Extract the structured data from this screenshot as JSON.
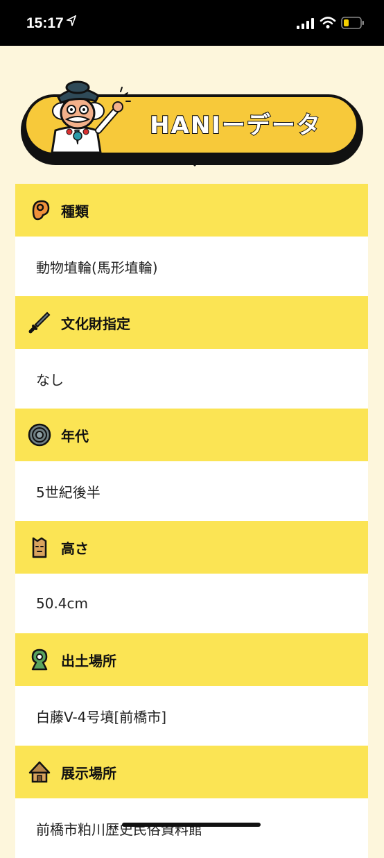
{
  "status_bar": {
    "time": "15:17"
  },
  "banner": {
    "title": "HANIーデータ"
  },
  "sections": [
    {
      "title": "種類",
      "value": "動物埴輪(馬形埴輪)",
      "icon": "haniwa-head-icon"
    },
    {
      "title": "文化財指定",
      "value": "なし",
      "icon": "sword-icon"
    },
    {
      "title": "年代",
      "value": "5世紀後半",
      "icon": "bronze-mirror-icon"
    },
    {
      "title": "高さ",
      "value": "50.4cm",
      "icon": "haniwa-figure-icon"
    },
    {
      "title": "出土場所",
      "value": "白藤V-4号墳[前橋市]",
      "icon": "keyhole-tomb-icon"
    },
    {
      "title": "展示場所",
      "value": "前橋市粕川歴史民俗資料館",
      "icon": "thatched-house-icon"
    }
  ],
  "colors": {
    "background": "#fdf6dc",
    "header_yellow": "#fbe454",
    "banner_yellow": "#f7c93a"
  }
}
